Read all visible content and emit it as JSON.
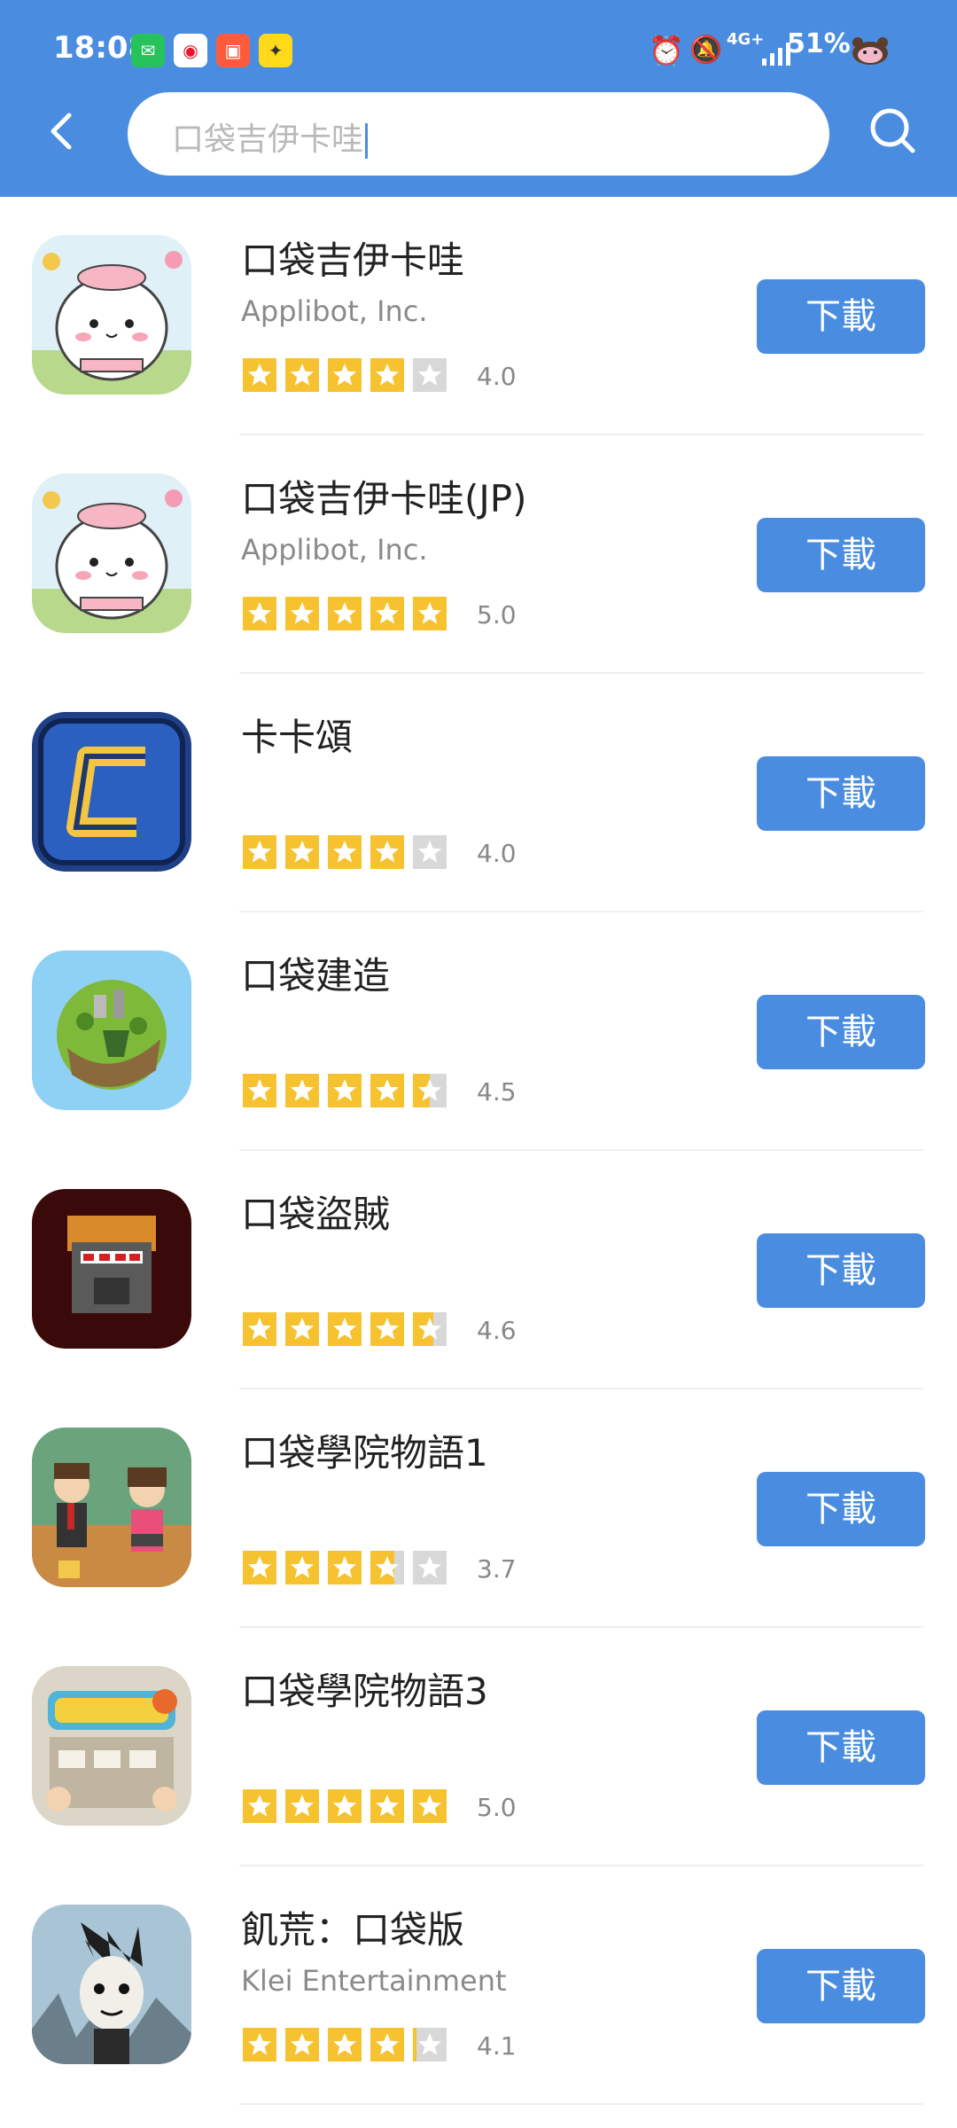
{
  "status_bar": {
    "time": "18:08",
    "network": "4G+",
    "battery": "51%",
    "icons": [
      "wechat-icon",
      "weibo-icon",
      "app-icon",
      "ticket-icon",
      "alarm-icon",
      "mute-icon",
      "signal-icon",
      "pet-icon"
    ]
  },
  "header": {
    "search_value": "口袋吉伊卡哇",
    "accent_color": "#4a8de0"
  },
  "apps": [
    {
      "name": "口袋吉伊卡哇",
      "developer": "Applibot, Inc.",
      "rating": "4.0",
      "stars": 4.0,
      "download_label": "下載",
      "icon": "chiikawa-icon"
    },
    {
      "name": "口袋吉伊卡哇(JP)",
      "developer": "Applibot, Inc.",
      "rating": "5.0",
      "stars": 5.0,
      "download_label": "下載",
      "icon": "chiikawa-icon"
    },
    {
      "name": "卡卡頌",
      "developer": "",
      "rating": "4.0",
      "stars": 4.0,
      "download_label": "下載",
      "icon": "carcassonne-icon"
    },
    {
      "name": "口袋建造",
      "developer": "",
      "rating": "4.5",
      "stars": 4.5,
      "download_label": "下載",
      "icon": "pocket-build-icon"
    },
    {
      "name": "口袋盜賊",
      "developer": "",
      "rating": "4.6",
      "stars": 4.6,
      "download_label": "下載",
      "icon": "pocket-rogues-icon"
    },
    {
      "name": "口袋學院物語1",
      "developer": "",
      "rating": "3.7",
      "stars": 3.7,
      "download_label": "下載",
      "icon": "pocket-academy-icon"
    },
    {
      "name": "口袋學院物語3",
      "developer": "",
      "rating": "5.0",
      "stars": 5.0,
      "download_label": "下載",
      "icon": "pocket-academy3-icon"
    },
    {
      "name": "飢荒：口袋版",
      "developer": "Klei Entertainment",
      "rating": "4.1",
      "stars": 4.1,
      "download_label": "下載",
      "icon": "dont-starve-icon"
    }
  ]
}
